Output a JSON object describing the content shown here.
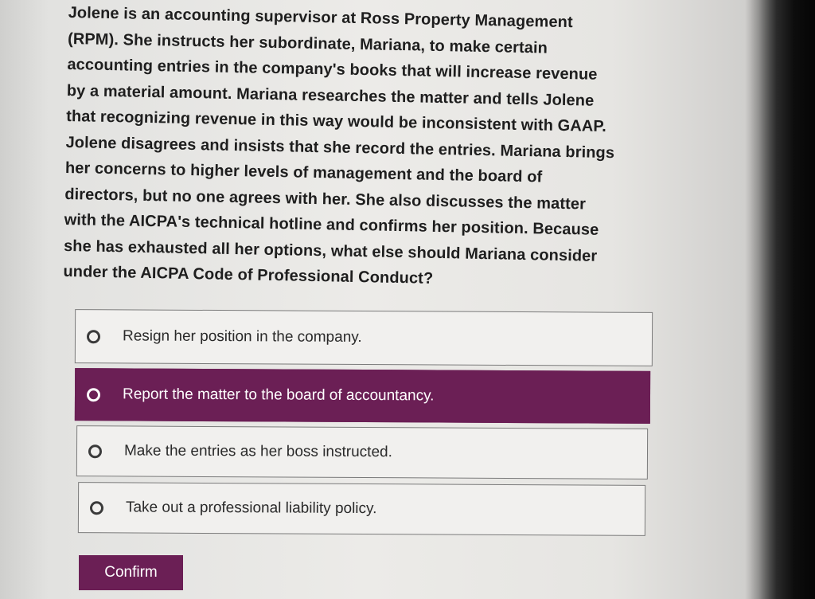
{
  "question": {
    "lines": [
      "Jolene is an accounting supervisor at Ross Property Management",
      "(RPM). She instructs her subordinate, Mariana, to make certain",
      "accounting entries in the company's books that will increase revenue",
      "by a material amount. Mariana researches the matter and tells Jolene",
      "that recognizing revenue in this way would be inconsistent with GAAP.",
      "Jolene disagrees and insists that she record the entries. Mariana brings",
      "her concerns to higher levels of management and the board of",
      "directors, but no one agrees with her. She also discusses the matter",
      "with the AICPA's technical hotline and confirms her position. Because",
      "she has exhausted all her options, what else should Mariana consider",
      "under the AICPA Code of Professional Conduct?"
    ]
  },
  "options": [
    {
      "label": "Resign her position in the company.",
      "selected": false
    },
    {
      "label": "Report the matter to the board of accountancy.",
      "selected": true
    },
    {
      "label": "Make the entries as her boss instructed.",
      "selected": false
    },
    {
      "label": "Take out a professional liability policy.",
      "selected": false
    }
  ],
  "confirm_button": {
    "label": "Confirm"
  },
  "colors": {
    "accent": "#6b1f55",
    "background": "#ecebe8",
    "text": "#1e1e1e"
  },
  "icons": {
    "radio_unselected": "radio-circle-icon",
    "radio_selected": "radio-circle-icon"
  }
}
